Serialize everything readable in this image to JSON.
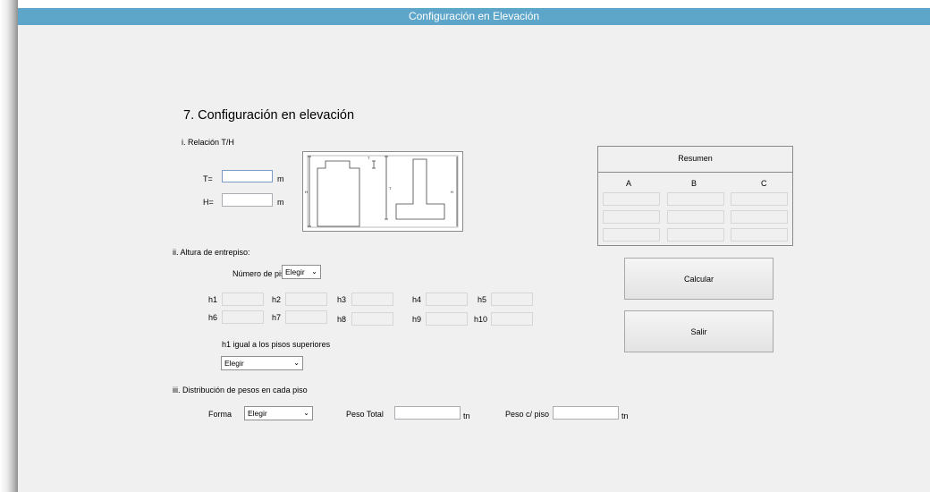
{
  "window": {
    "title": "Configuración en Elevación"
  },
  "heading": "7. Configuración en elevación",
  "section1": {
    "title": "i. Relación T/H",
    "t_label": "T=",
    "t_value": "",
    "t_unit": "m",
    "h_label": "H=",
    "h_value": "",
    "h_unit": "m"
  },
  "diagram": {
    "label_t_small": "T",
    "label_h_left": "H",
    "label_t_mid": "T",
    "label_h_right": "H"
  },
  "summary": {
    "title": "Resumen",
    "columns": [
      "A",
      "B",
      "C"
    ],
    "rows": [
      [
        "",
        "",
        ""
      ],
      [
        "",
        "",
        ""
      ],
      [
        "",
        "",
        ""
      ]
    ]
  },
  "buttons": {
    "calcular": "Calcular",
    "salir": "Salir"
  },
  "section2": {
    "title": "ii. Altura de entrepiso:",
    "floors_label": "Número de pisos",
    "floors_value": "Elegir",
    "heights": [
      {
        "label": "h1",
        "value": ""
      },
      {
        "label": "h2",
        "value": ""
      },
      {
        "label": "h3",
        "value": ""
      },
      {
        "label": "h4",
        "value": ""
      },
      {
        "label": "h5",
        "value": ""
      },
      {
        "label": "h6",
        "value": ""
      },
      {
        "label": "h7",
        "value": ""
      },
      {
        "label": "h8",
        "value": ""
      },
      {
        "label": "h9",
        "value": ""
      },
      {
        "label": "h10",
        "value": ""
      }
    ],
    "h1_equal_label": "h1 igual a los pisos superiores",
    "h1_equal_value": "Elegir"
  },
  "section3": {
    "title": "iii. Distribución de pesos en cada piso",
    "forma_label": "Forma",
    "forma_value": "Elegir",
    "peso_total_label": "Peso Total",
    "peso_total_value": "",
    "peso_total_unit": "tn",
    "peso_piso_label": "Peso c/ piso",
    "peso_piso_value": "",
    "peso_piso_unit": "tn"
  },
  "icons": {
    "dropdown": "chevron-down-icon"
  }
}
